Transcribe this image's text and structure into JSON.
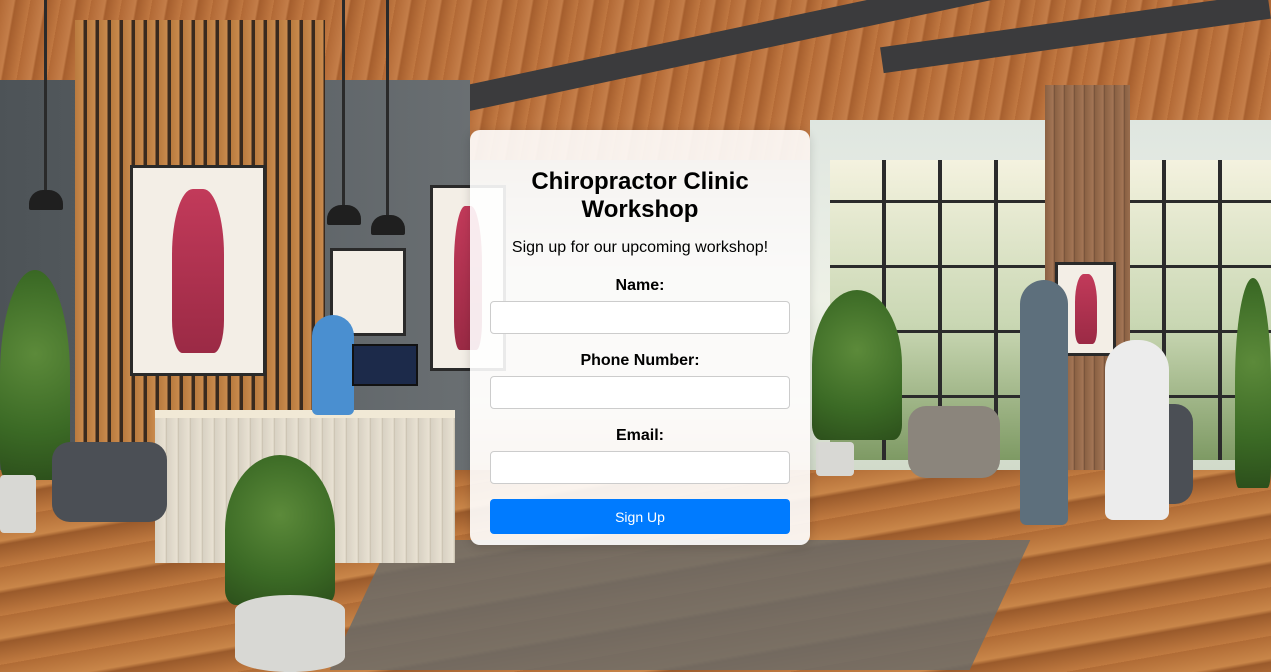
{
  "page": {
    "background_description_icon": "clinic-background-image"
  },
  "form": {
    "title": "Chiropractor Clinic Workshop",
    "subtitle": "Sign up for our upcoming workshop!",
    "fields": [
      {
        "label": "Name:",
        "value": "",
        "placeholder": ""
      },
      {
        "label": "Phone Number:",
        "value": "",
        "placeholder": ""
      },
      {
        "label": "Email:",
        "value": "",
        "placeholder": ""
      }
    ],
    "submit_label": "Sign Up"
  },
  "colors": {
    "accent": "#007bff",
    "card_background": "rgba(255,255,255,0.9)"
  }
}
